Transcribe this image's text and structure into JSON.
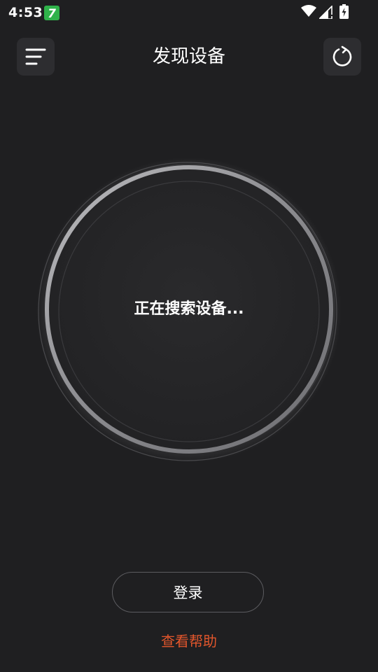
{
  "status_bar": {
    "time": "4:53",
    "notification_badge": "7",
    "icons": [
      "wifi-icon",
      "signal-icon",
      "battery-charging-icon"
    ]
  },
  "header": {
    "title": "发现设备",
    "menu_icon": "menu-lines-icon",
    "refresh_icon": "refresh-icon"
  },
  "scanner": {
    "status_text": "正在搜索设备..."
  },
  "footer": {
    "login_label": "登录",
    "help_label": "查看帮助"
  },
  "colors": {
    "background": "#1f1f21",
    "button_bg": "#2d2d30",
    "help_link": "#e2562c",
    "notif_badge": "#2fb24a"
  }
}
